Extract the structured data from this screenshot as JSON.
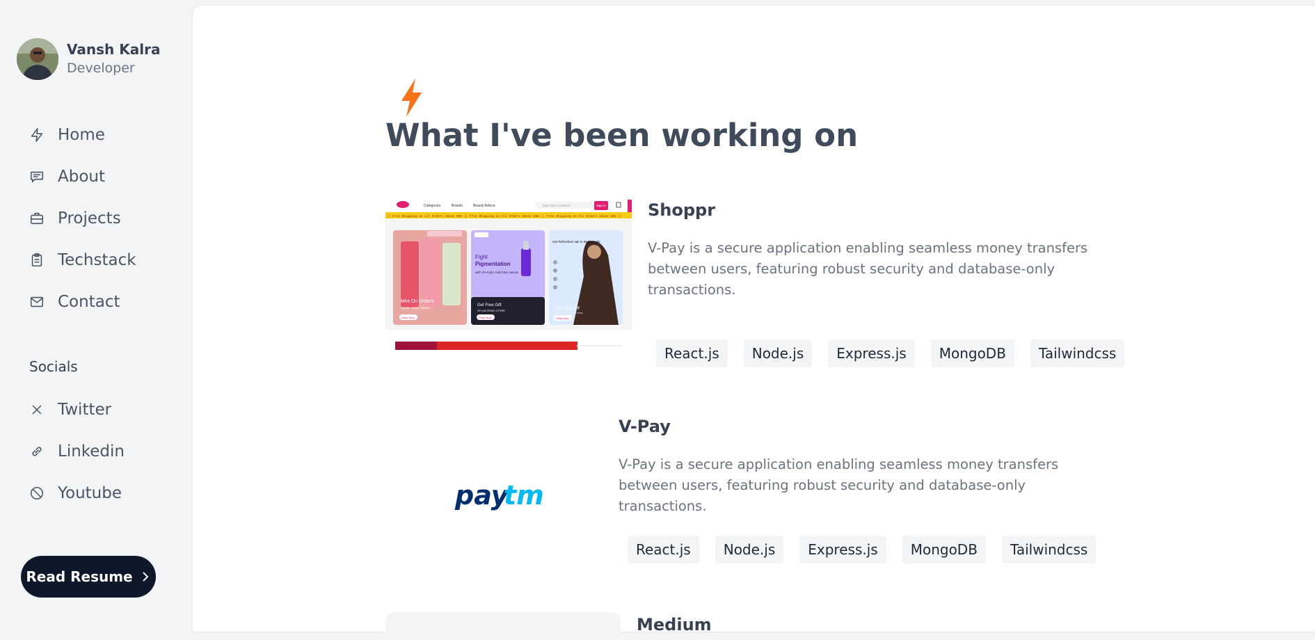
{
  "profile": {
    "name": "Vansh Kalra",
    "role": "Developer"
  },
  "nav": [
    {
      "label": "Home",
      "icon": "bolt-icon"
    },
    {
      "label": "About",
      "icon": "chat-icon"
    },
    {
      "label": "Projects",
      "icon": "briefcase-icon"
    },
    {
      "label": "Techstack",
      "icon": "clipboard-icon"
    },
    {
      "label": "Contact",
      "icon": "mail-icon"
    }
  ],
  "socials": {
    "heading": "Socials",
    "items": [
      {
        "label": "Twitter",
        "icon": "x-icon"
      },
      {
        "label": "Linkedin",
        "icon": "link-icon"
      },
      {
        "label": "Youtube",
        "icon": "ban-icon"
      }
    ]
  },
  "resume_button": "Read Resume",
  "main": {
    "title": "What I've been working on",
    "projects": [
      {
        "title": "Shoppr",
        "description": "V-Pay is a secure application enabling seamless money transfers between users, featuring robust security and database-only transactions.",
        "tags": [
          "React.js",
          "Node.js",
          "Express.js",
          "MongoDB",
          "Tailwindcss"
        ],
        "thumb": {
          "menu": [
            "Categories",
            "Brands",
            "Beauty Advice"
          ],
          "search_placeholder": "Type here to search...",
          "signin": "Sign in",
          "ticker": "|| Free Shipping on All Orders Above 599 || Free Shipping on All Orders Above 599 || Free Shipping on All Orders Above 599 ||",
          "card1": "Mini On Orders",
          "card1_sub": "Sweat, swipe, Shine!",
          "card2_heading": "Fight",
          "card2_highlight": "Pigmentation",
          "card2_body": "with 2% Kojic Acid Face Serum",
          "card2_offer": "Get Free Gift",
          "card2_offer_sub": "On purchase of 599",
          "card3_heading": "Get Refreshed Hair in 60 Seconds",
          "card3_offer": "Upto 25% Off",
          "card3_offer_sub": "Loaded for Bristol Clus",
          "shop_now": "Shop Now"
        }
      },
      {
        "title": "V-Pay",
        "description": "V-Pay is a secure application enabling seamless money transfers between users, featuring robust security and database-only transactions.",
        "tags": [
          "React.js",
          "Node.js",
          "Express.js",
          "MongoDB",
          "Tailwindcss"
        ],
        "logo": {
          "part1": "pay",
          "part2": "tm",
          "color1": "#002e6e",
          "color2": "#00baf2"
        }
      },
      {
        "title": "Medium"
      }
    ]
  },
  "colors": {
    "accent": "#f97316",
    "dark_button": "#0f172a",
    "paytm_dark": "#002e6e",
    "paytm_light": "#00baf2"
  }
}
